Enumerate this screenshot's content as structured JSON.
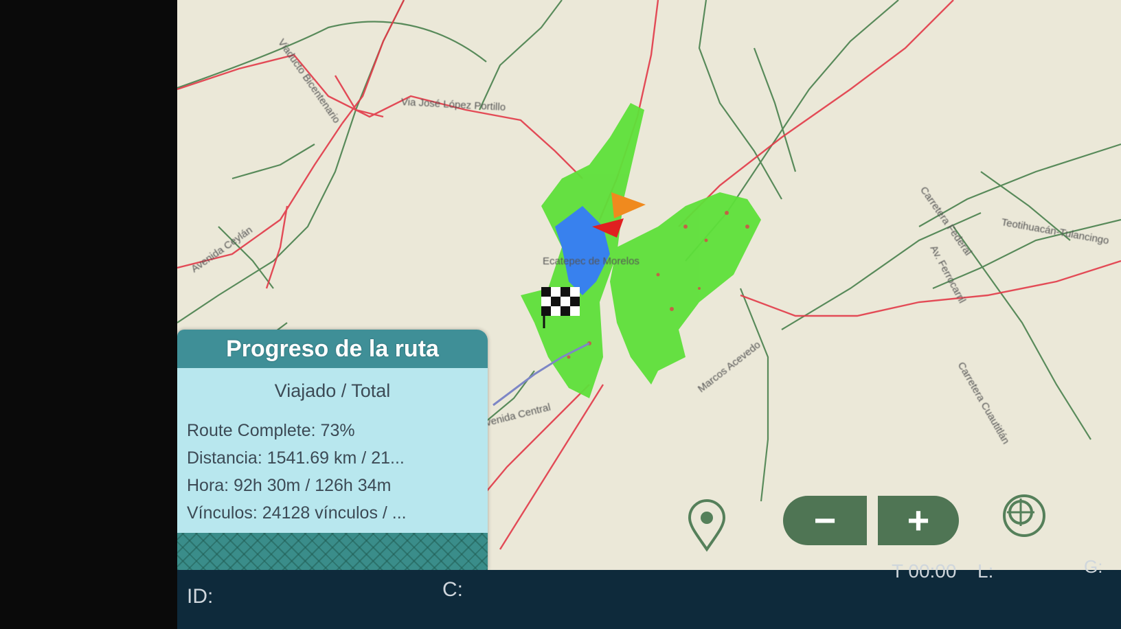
{
  "map": {
    "road_labels": [
      "Via José López Portillo",
      "Viaducto Bicentenario",
      "Avenida Ceylán",
      "Ecatepec de Morelos",
      "Avenida Central",
      "Marcos Acevedo",
      "Teotihuacán-Tulancingo",
      "Carretera Federal",
      "Carretera Cuautitlán",
      "Av. Ferrocarril"
    ],
    "colors": {
      "background": "#ebe8d8",
      "primary_road": "#e23a48",
      "secondary_road": "#3f7a45",
      "coverage_area": "#5ee03a",
      "traveled_area": "#2f7cf0"
    },
    "icons": [
      "start-flag-icon",
      "current-position-icon",
      "finish-flag-icon"
    ]
  },
  "progress_panel": {
    "title": "Progreso de la ruta",
    "subtitle": "Viajado / Total",
    "route_complete": "Route Complete: 73%",
    "route_complete_percent": 73,
    "distance": "Distancia: 1541.69 km / 21...",
    "time": "Hora: 92h 30m / 126h 34m",
    "links": "Vínculos: 24128 vínculos / ..."
  },
  "controls": {
    "zoom_out_label": "−",
    "zoom_in_label": "+",
    "icons": [
      "gps-pin-icon",
      "zoom-out-icon",
      "zoom-in-icon",
      "crosshair-icon"
    ]
  },
  "status_bar": {
    "id_label": "ID:",
    "c_label": "C:",
    "timer": "T 00:00",
    "l_label": "L:",
    "g_label": "G:"
  }
}
